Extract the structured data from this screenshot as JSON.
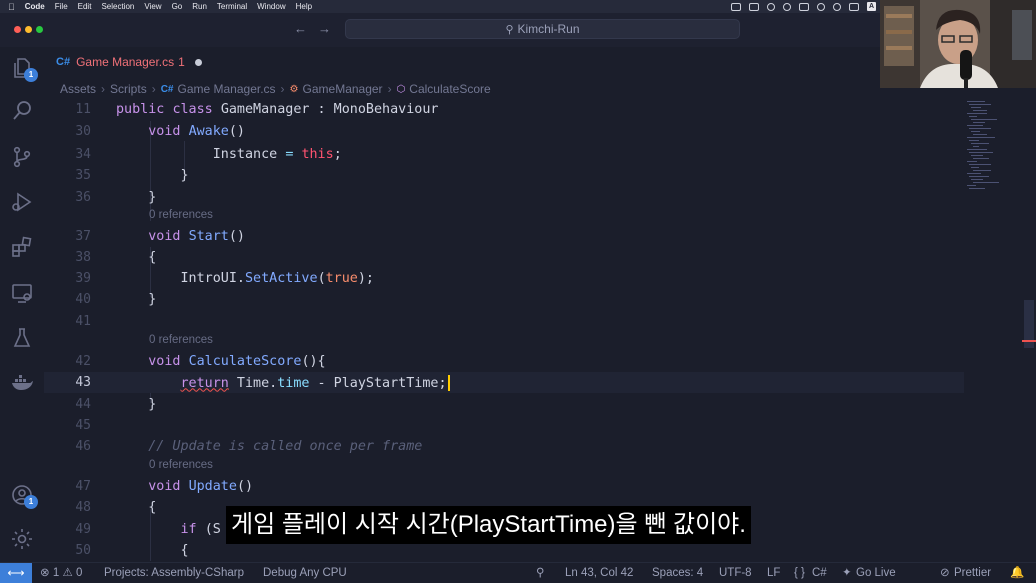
{
  "menubar": {
    "app": "Code",
    "items": [
      "File",
      "Edit",
      "Selection",
      "View",
      "Go",
      "Run",
      "Terminal",
      "Window",
      "Help"
    ],
    "input_badge": "A"
  },
  "titlebar": {
    "search_text": "Kimchi-Run"
  },
  "tab": {
    "icon": "C#",
    "label": "Game Manager.cs",
    "problem_count": "1"
  },
  "breadcrumb": [
    "Assets",
    "Scripts",
    "Game Manager.cs",
    "GameManager",
    "CalculateScore"
  ],
  "activity": {
    "explorer_badge": "1",
    "accounts_badge": "1"
  },
  "editor": {
    "lines": [
      {
        "n": "11",
        "tokens": [
          [
            "kw",
            "public "
          ],
          [
            "kw",
            "class "
          ],
          [
            "plain",
            "GameManager : MonoBehaviour"
          ]
        ]
      },
      {
        "n": "30",
        "tokens": [
          [
            "plain",
            "    "
          ],
          [
            "kw",
            "void "
          ],
          [
            "fn",
            "Awake"
          ],
          [
            "plain",
            "()"
          ]
        ]
      },
      {
        "n": "34",
        "tokens": [
          [
            "plain",
            "            Instance "
          ],
          [
            "op",
            "= "
          ],
          [
            "this",
            "this"
          ],
          [
            "plain",
            ";"
          ]
        ]
      },
      {
        "n": "35",
        "tokens": [
          [
            "plain",
            "        }"
          ]
        ]
      },
      {
        "n": "36",
        "tokens": [
          [
            "plain",
            "    }"
          ]
        ]
      },
      {
        "n": "37",
        "tokens": [
          [
            "plain",
            "    "
          ],
          [
            "kw",
            "void "
          ],
          [
            "fn",
            "Start"
          ],
          [
            "plain",
            "()"
          ]
        ]
      },
      {
        "n": "38",
        "tokens": [
          [
            "plain",
            "    {"
          ]
        ]
      },
      {
        "n": "39",
        "tokens": [
          [
            "plain",
            "        IntroUI."
          ],
          [
            "fn",
            "SetActive"
          ],
          [
            "plain",
            "("
          ],
          [
            "tru",
            "true"
          ],
          [
            "plain",
            ");"
          ]
        ]
      },
      {
        "n": "40",
        "tokens": [
          [
            "plain",
            "    }"
          ]
        ]
      },
      {
        "n": "41",
        "tokens": [
          [
            "plain",
            ""
          ]
        ]
      },
      {
        "n": "42",
        "tokens": [
          [
            "plain",
            "    "
          ],
          [
            "kw",
            "void "
          ],
          [
            "fn",
            "CalculateScore"
          ],
          [
            "plain",
            "(){"
          ]
        ]
      },
      {
        "n": "43",
        "tokens": [
          [
            "plain",
            "        "
          ],
          [
            "squig",
            "return"
          ],
          [
            "plain",
            " Time."
          ],
          [
            "prop",
            "time"
          ],
          [
            "plain",
            " - PlayStartTime;"
          ]
        ]
      },
      {
        "n": "44",
        "tokens": [
          [
            "plain",
            "    }"
          ]
        ]
      },
      {
        "n": "45",
        "tokens": [
          [
            "plain",
            ""
          ]
        ]
      },
      {
        "n": "46",
        "tokens": [
          [
            "plain",
            "    "
          ],
          [
            "comment",
            "// Update is called once per frame"
          ]
        ]
      },
      {
        "n": "47",
        "tokens": [
          [
            "plain",
            "    "
          ],
          [
            "kw",
            "void "
          ],
          [
            "fn",
            "Update"
          ],
          [
            "plain",
            "()"
          ]
        ]
      },
      {
        "n": "48",
        "tokens": [
          [
            "plain",
            "    {"
          ]
        ]
      },
      {
        "n": "49",
        "tokens": [
          [
            "plain",
            "        "
          ],
          [
            "kw",
            "if "
          ],
          [
            "plain",
            "(S"
          ]
        ]
      },
      {
        "n": "50",
        "tokens": [
          [
            "plain",
            "        {"
          ]
        ]
      }
    ],
    "codelens": [
      "0 references",
      "0 references",
      "0 references"
    ]
  },
  "subtitle": "게임 플레이 시작 시간(PlayStartTime)을 뺀 값이야.",
  "statusbar": {
    "errors": "1",
    "warnings": "0",
    "project": "Projects: Assembly-CSharp",
    "debug": "Debug Any CPU",
    "position": "Ln 43, Col 42",
    "spaces": "Spaces: 4",
    "encoding": "UTF-8",
    "eol": "LF",
    "language": "C#",
    "golive": "Go Live",
    "prettier": "Prettier"
  }
}
